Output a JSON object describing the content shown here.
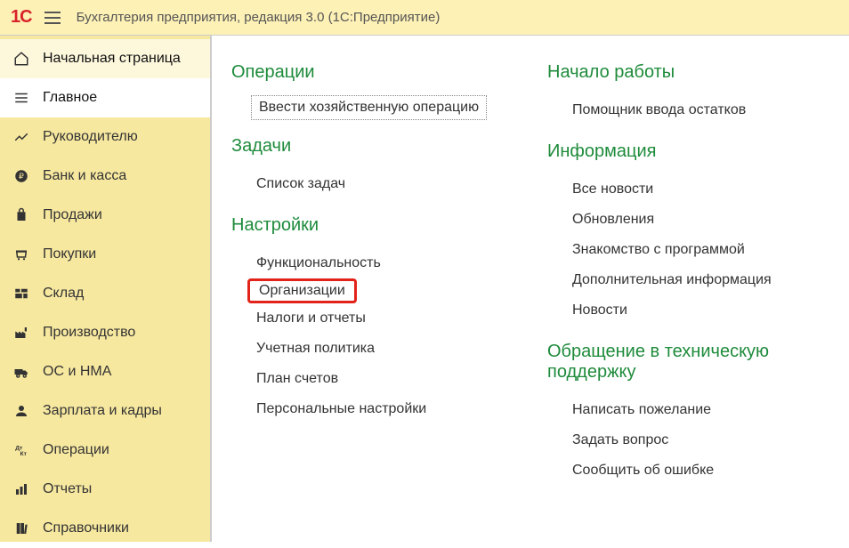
{
  "app_title": "Бухгалтерия предприятия, редакция 3.0   (1С:Предприятие)",
  "logo_text": "1С",
  "sidebar": {
    "home": "Начальная страница",
    "items": [
      {
        "icon": "menu",
        "label": "Главное",
        "kind": "main"
      },
      {
        "icon": "chart",
        "label": "Руководителю",
        "kind": ""
      },
      {
        "icon": "ruble",
        "label": "Банк и касса",
        "kind": ""
      },
      {
        "icon": "bag",
        "label": "Продажи",
        "kind": ""
      },
      {
        "icon": "cart",
        "label": "Покупки",
        "kind": ""
      },
      {
        "icon": "grid",
        "label": "Склад",
        "kind": ""
      },
      {
        "icon": "factory",
        "label": "Производство",
        "kind": ""
      },
      {
        "icon": "truck",
        "label": "ОС и НМА",
        "kind": ""
      },
      {
        "icon": "person",
        "label": "Зарплата и кадры",
        "kind": ""
      },
      {
        "icon": "dtkt",
        "label": "Операции",
        "kind": ""
      },
      {
        "icon": "bars",
        "label": "Отчеты",
        "kind": ""
      },
      {
        "icon": "books",
        "label": "Справочники",
        "kind": ""
      }
    ]
  },
  "col1": {
    "sec1_title": "Операции",
    "sec1_item": "Ввести хозяйственную операцию",
    "sec2_title": "Задачи",
    "sec2_item": "Список задач",
    "sec3_title": "Настройки",
    "sec3_items": [
      "Функциональность",
      "Организации",
      "Налоги и отчеты",
      "Учетная политика",
      "План счетов",
      "Персональные настройки"
    ]
  },
  "col2": {
    "sec1_title": "Начало работы",
    "sec1_item": "Помощник ввода остатков",
    "sec2_title": "Информация",
    "sec2_items": [
      "Все новости",
      "Обновления",
      "Знакомство с программой",
      "Дополнительная информация",
      "Новости"
    ],
    "sec3_title": "Обращение в техническую поддержку",
    "sec3_items": [
      "Написать пожелание",
      "Задать вопрос",
      "Сообщить об ошибке"
    ]
  }
}
